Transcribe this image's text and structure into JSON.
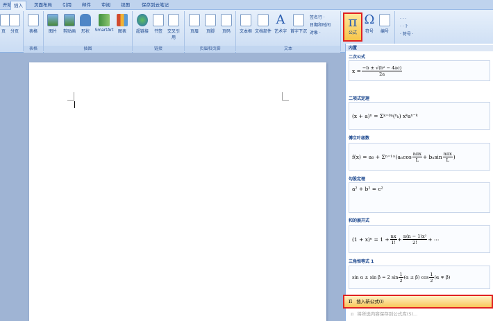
{
  "tabs": [
    "开始",
    "插入",
    "页面布局",
    "引用",
    "邮件",
    "审阅",
    "视图",
    "保存到云笔记"
  ],
  "ribbon": {
    "groups": [
      "表格",
      "插图",
      "链接",
      "页眉和页脚",
      "文本"
    ],
    "buttons": {
      "page": "页",
      "break": "分页",
      "table": "表格",
      "picture": "图片",
      "clipart": "剪贴画",
      "shapes": "形状",
      "smartart": "SmartArt",
      "chart": "图表",
      "hyperlink": "超链接",
      "bookmark": "书签",
      "crossref": "交叉引用",
      "header": "页眉",
      "footer": "页脚",
      "pagenum": "页码",
      "textbox": "文本框",
      "docparts": "文档部件",
      "wordart": "艺术字",
      "dropcap": "首字下沉",
      "equation": "公式",
      "symbol": "符号",
      "number": "编号"
    },
    "small": [
      "签名行 ·",
      "日期和时间",
      "对象 ·"
    ],
    "symbols_small": [
      "·  ·  ·",
      "·  ·  ?",
      "· 符号 ·"
    ]
  },
  "gallery": {
    "header_builtin": "内置",
    "items": [
      {
        "title": "二次公式"
      },
      {
        "title": "二项式定理"
      },
      {
        "title": "傅立叶级数"
      },
      {
        "title": "勾股定理"
      },
      {
        "title": "和的展开式"
      },
      {
        "title": "三角恒等式 1"
      }
    ],
    "header_builtin2": "内置",
    "insert_new": "插入新公式(I)",
    "save_selection": "将所选内容保存到公式库(S)..."
  }
}
